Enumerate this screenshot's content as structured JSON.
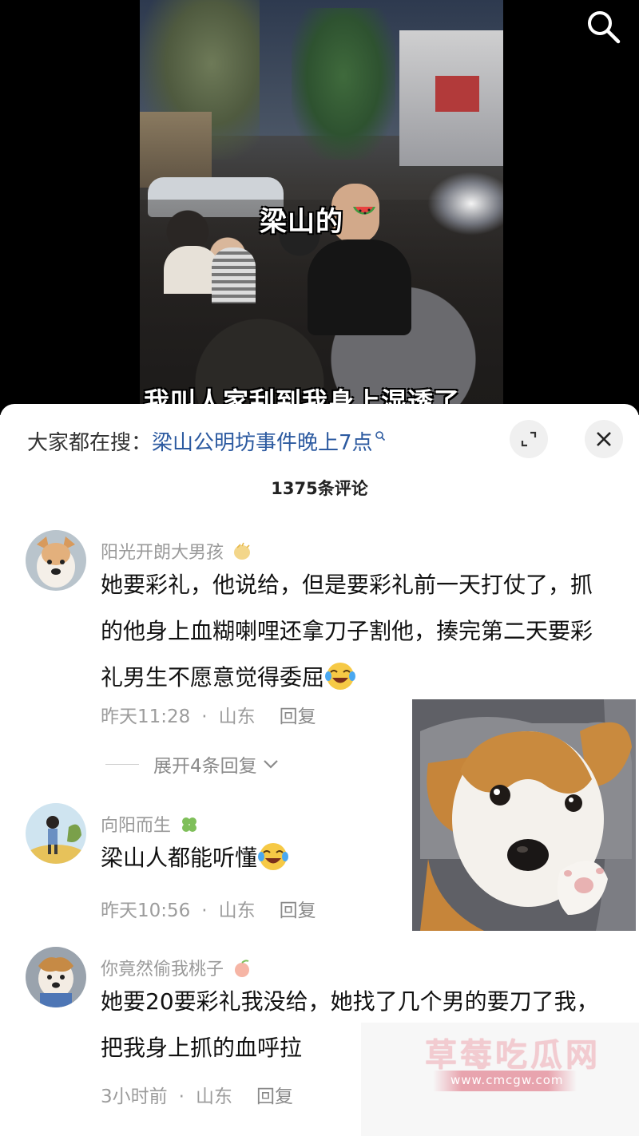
{
  "video": {
    "tag": "梁山的",
    "subtitle": "我叫人家刮到我身上湿透了"
  },
  "search_bar": {
    "hint": "大家都在搜：",
    "query": "梁山公明坊事件晚上7点"
  },
  "comment_count": "1375条评论",
  "comments": [
    {
      "username": "阳光开朗大男孩",
      "text": "她要彩礼，他说给，但是要彩礼前一天打仗了，抓的他身上血糊喇哩还拿刀子割他，揍完第二天要彩礼男生不愿意觉得委屈",
      "time": "昨天11:28",
      "location": "山东",
      "reply": "回复",
      "expand": "展开4条回复"
    },
    {
      "username": "向阳而生",
      "text": "梁山人都能听懂",
      "time": "昨天10:56",
      "location": "山东",
      "reply": "回复"
    },
    {
      "username": "你竟然偷我桃子",
      "text": "她要20要彩礼我没给，她找了几个男的要刀了我，把我身上抓的血呼拉",
      "time": "3小时前",
      "location": "山东",
      "reply": "回复"
    }
  ],
  "watermark": {
    "title": "草莓吃瓜网",
    "url": "www.cmcgw.com"
  },
  "icons": {
    "search": "search-icon",
    "expand": "expand-icon",
    "close": "close-icon",
    "chevron": "chevron-down-icon"
  },
  "colors": {
    "query_link": "#2c5aa0",
    "meta_gray": "#9c9c9c",
    "watermark_pink": "#e8a4ae"
  }
}
